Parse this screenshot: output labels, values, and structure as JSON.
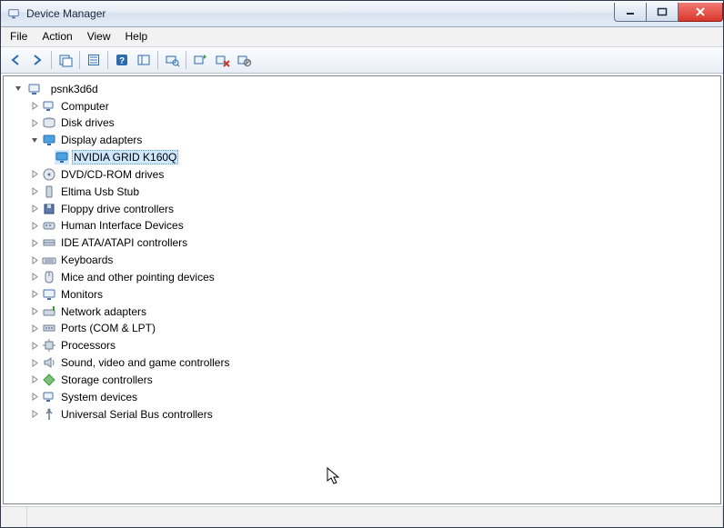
{
  "title": "Device Manager",
  "menus": [
    "File",
    "Action",
    "View",
    "Help"
  ],
  "toolbar": [
    {
      "name": "nav-back-icon"
    },
    {
      "name": "nav-forward-icon"
    },
    {
      "sep": true
    },
    {
      "name": "show-hidden-icon"
    },
    {
      "sep": true
    },
    {
      "name": "properties-icon"
    },
    {
      "sep": true
    },
    {
      "name": "help-icon"
    },
    {
      "name": "console-tree-icon"
    },
    {
      "sep": true
    },
    {
      "name": "scan-hardware-icon"
    },
    {
      "sep": true
    },
    {
      "name": "update-driver-icon"
    },
    {
      "name": "uninstall-icon"
    },
    {
      "name": "disable-icon"
    }
  ],
  "tree": {
    "root": {
      "label": "psnk3d6d",
      "icon": "computer-root-icon",
      "expanded": true
    },
    "children": [
      {
        "label": "Computer",
        "icon": "computer-icon",
        "expanded": false
      },
      {
        "label": "Disk drives",
        "icon": "disk-icon",
        "expanded": false
      },
      {
        "label": "Display adapters",
        "icon": "display-icon",
        "expanded": true,
        "children": [
          {
            "label": "NVIDIA GRID K160Q",
            "icon": "display-icon",
            "selected": true
          }
        ]
      },
      {
        "label": "DVD/CD-ROM drives",
        "icon": "optical-icon",
        "expanded": false
      },
      {
        "label": "Eltima Usb Stub",
        "icon": "usb-stub-icon",
        "expanded": false
      },
      {
        "label": "Floppy drive controllers",
        "icon": "floppy-icon",
        "expanded": false
      },
      {
        "label": "Human Interface Devices",
        "icon": "hid-icon",
        "expanded": false
      },
      {
        "label": "IDE ATA/ATAPI controllers",
        "icon": "ide-icon",
        "expanded": false
      },
      {
        "label": "Keyboards",
        "icon": "keyboard-icon",
        "expanded": false
      },
      {
        "label": "Mice and other pointing devices",
        "icon": "mouse-icon",
        "expanded": false
      },
      {
        "label": "Monitors",
        "icon": "monitor-icon",
        "expanded": false
      },
      {
        "label": "Network adapters",
        "icon": "network-icon",
        "expanded": false
      },
      {
        "label": "Ports (COM & LPT)",
        "icon": "port-icon",
        "expanded": false
      },
      {
        "label": "Processors",
        "icon": "cpu-icon",
        "expanded": false
      },
      {
        "label": "Sound, video and game controllers",
        "icon": "sound-icon",
        "expanded": false
      },
      {
        "label": "Storage controllers",
        "icon": "storage-icon",
        "expanded": false
      },
      {
        "label": "System devices",
        "icon": "system-icon",
        "expanded": false
      },
      {
        "label": "Universal Serial Bus controllers",
        "icon": "usb-icon",
        "expanded": false
      }
    ]
  }
}
